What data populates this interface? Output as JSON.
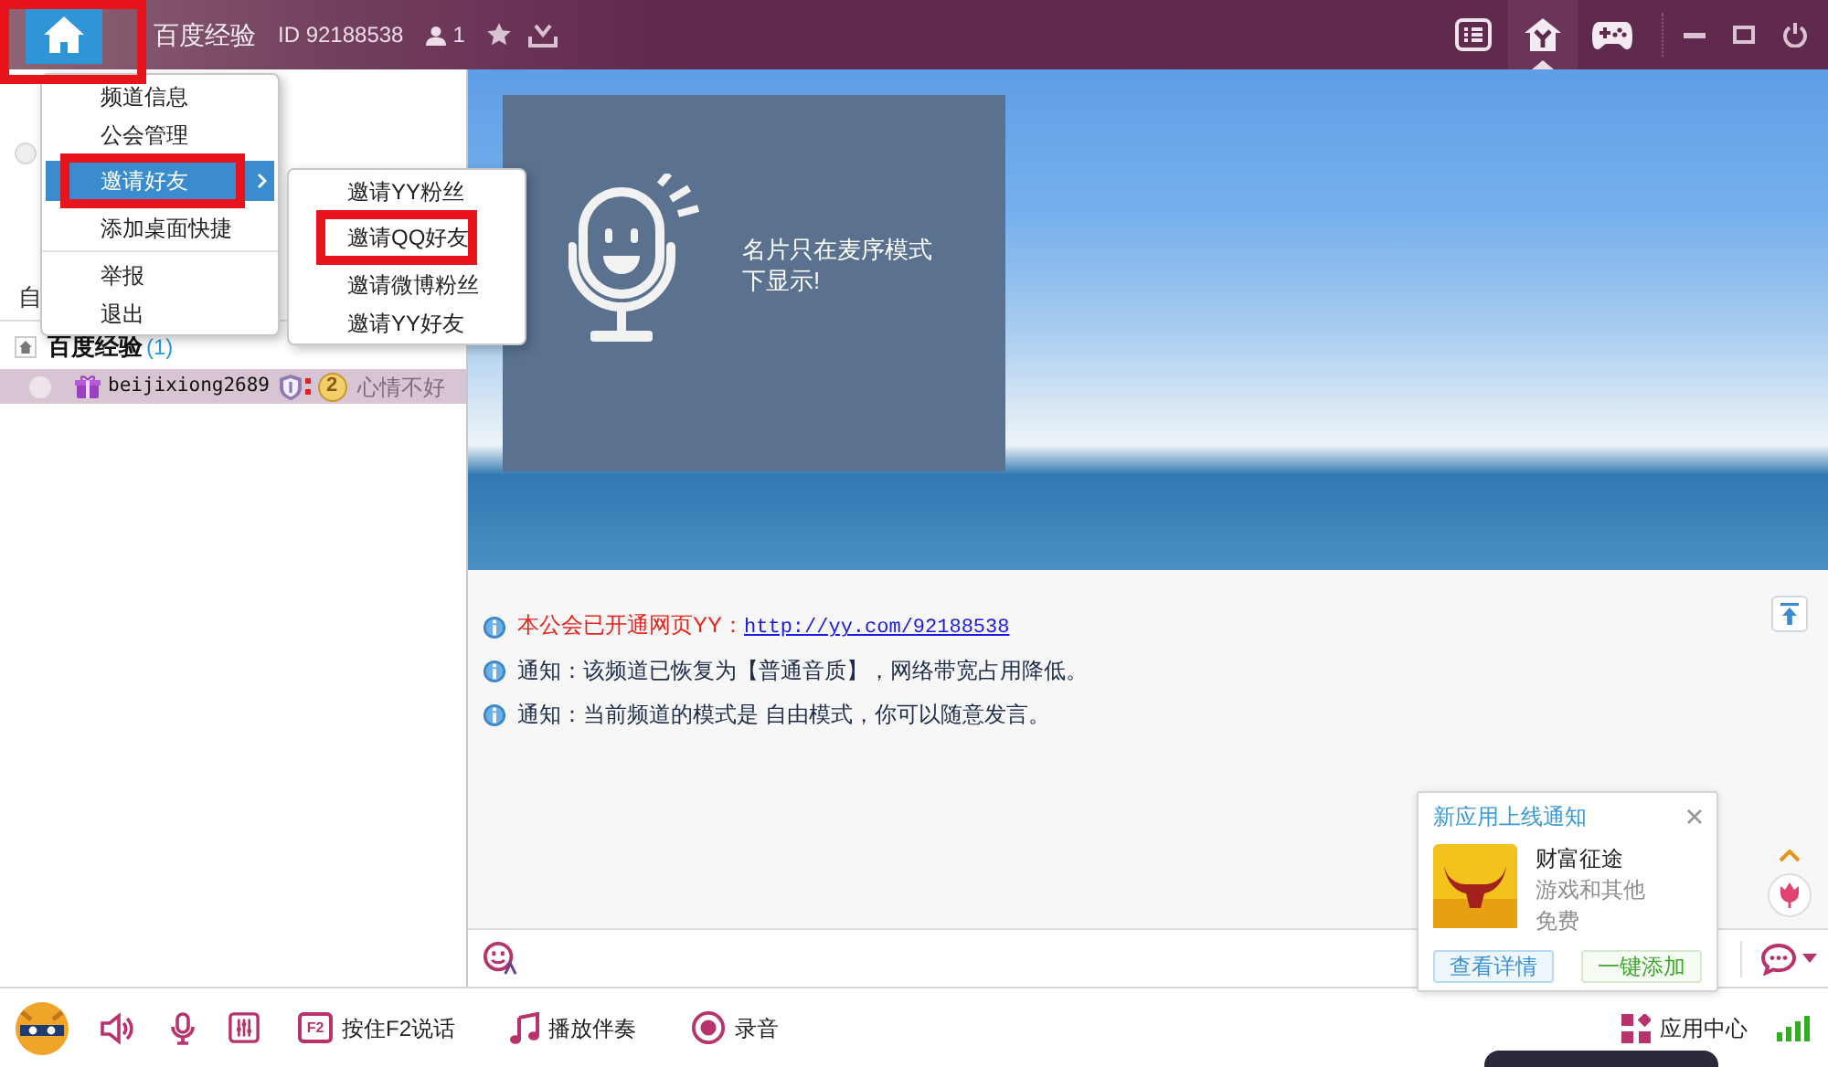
{
  "title_bar": {
    "home_button": {
      "annotated": true
    },
    "channel_name": "百度经验",
    "channel_id": "ID 92188538",
    "online_count": "1",
    "tabs": [
      {
        "kind": "list",
        "selected": false
      },
      {
        "kind": "home",
        "selected": true
      },
      {
        "kind": "game",
        "selected": false
      }
    ]
  },
  "left_panel": {
    "tab_label": "自",
    "tree": [
      {
        "label": "百度经验",
        "count": "(1)",
        "children": [
          {
            "name": "beijixiong2689",
            "rank_badge": "2",
            "mood": "心情不好",
            "selected": true
          }
        ]
      }
    ]
  },
  "home_menu": {
    "sections": [
      {
        "items": [
          {
            "label": "频道信息",
            "selected": false,
            "annotated": false
          },
          {
            "label": "公会管理",
            "selected": false,
            "annotated": false
          },
          {
            "label": "邀请好友",
            "selected": true,
            "annotated": true,
            "submenu": [
              {
                "label": "邀请YY粉丝",
                "annotated": false
              },
              {
                "label": "邀请QQ好友",
                "annotated": true
              },
              {
                "label": "邀请微博粉丝",
                "annotated": false
              },
              {
                "label": "邀请YY好友",
                "annotated": false
              }
            ]
          },
          {
            "label": "添加桌面快捷",
            "selected": false,
            "annotated": false
          }
        ]
      },
      {
        "items": [
          {
            "label": "举报",
            "selected": false,
            "annotated": false
          },
          {
            "label": "退出",
            "selected": false,
            "annotated": false
          }
        ]
      }
    ]
  },
  "card": {
    "text": "名片只在麦序模式下显示!"
  },
  "messages": [
    {
      "kind": "link",
      "text": "本公会已开通网页YY：",
      "link": "http://yy.com/92188538"
    },
    {
      "kind": "notice",
      "text": "通知：该频道已恢复为【普通音质】，网络带宽占用降低。"
    },
    {
      "kind": "notice",
      "text": "通知：当前频道的模式是 自由模式，你可以随意发言。"
    }
  ],
  "notification": {
    "title": "新应用上线通知",
    "app_name": "财富征途",
    "description_lines": [
      "游戏和其他",
      "免费"
    ],
    "buttons": [
      {
        "kind": "details",
        "label": "查看详情"
      },
      {
        "kind": "add",
        "label": "一键添加"
      }
    ]
  },
  "bottom_bar": {
    "actions": [
      {
        "kind": "key",
        "key": "F2",
        "label": "按住F2说话"
      },
      {
        "kind": "music",
        "label": "播放伴奏"
      },
      {
        "kind": "record",
        "label": "录音"
      }
    ],
    "app_center": "应用中心"
  }
}
